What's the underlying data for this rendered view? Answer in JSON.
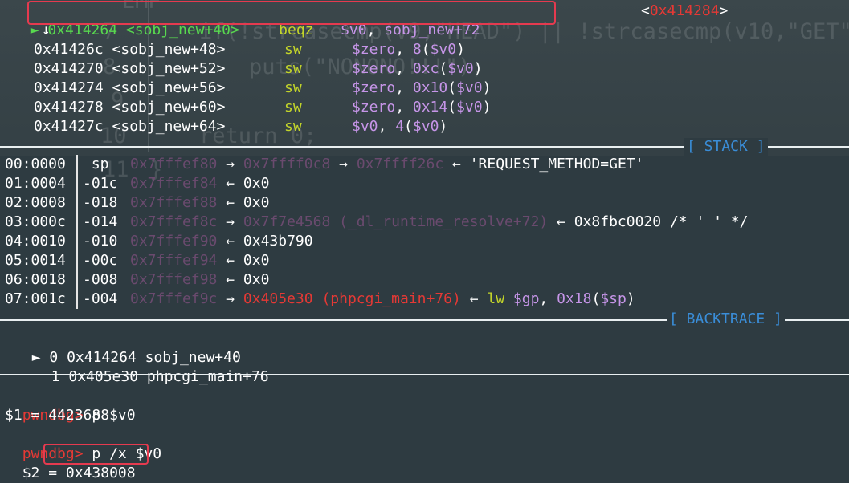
{
  "ghost": {
    "l7_num": "7",
    "l7_code": "if(!strcasecmp(v9,\"HEAD\") || !strcasecmp(v10,\"GET\"",
    "l8_num": "8",
    "l8_code": "puts(\"NONONO!!!\");",
    "l9_num": "9",
    "l10_num": "10",
    "l10_code": "return 0;",
    "l11_num": "11",
    "l11_code": "}",
    "top_frag": "EMP  "
  },
  "disasm": {
    "current": {
      "marker": "►",
      "addr": "0x414264",
      "sym": "<sobj_new+40>",
      "mnemonic": "beqz",
      "op1": "$v0",
      "op2": "sobj_new+72",
      "target_lt": "<",
      "target": "0x414284",
      "target_gt": ">"
    },
    "arrow": "↓",
    "lines": [
      {
        "addr": "0x41426c",
        "sym": "<sobj_new+48>",
        "mnemonic": "sw",
        "op1": "$zero",
        "off": "8",
        "base": "$v0"
      },
      {
        "addr": "0x414270",
        "sym": "<sobj_new+52>",
        "mnemonic": "sw",
        "op1": "$zero",
        "off": "0xc",
        "base": "$v0"
      },
      {
        "addr": "0x414274",
        "sym": "<sobj_new+56>",
        "mnemonic": "sw",
        "op1": "$zero",
        "off": "0x10",
        "base": "$v0"
      },
      {
        "addr": "0x414278",
        "sym": "<sobj_new+60>",
        "mnemonic": "sw",
        "op1": "$zero",
        "off": "0x14",
        "base": "$v0"
      },
      {
        "addr": "0x41427c",
        "sym": "<sobj_new+64>",
        "mnemonic": "sw",
        "op1": "$v0",
        "off": "4",
        "base": "$v0"
      }
    ]
  },
  "stack": {
    "title": "[ STACK ]",
    "rows": [
      {
        "idx": "00:0000",
        "off": " sp",
        "addr": "0x7fffef80",
        "a1": "→",
        "p1": "0x7ffff0c8",
        "a2": "→",
        "p2": "0x7ffff26c",
        "a3": "←",
        "val": "'REQUEST_METHOD=GET'"
      },
      {
        "idx": "01:0004",
        "off": "-01c",
        "addr": "0x7fffef84",
        "a3": "←",
        "val": "0x0"
      },
      {
        "idx": "02:0008",
        "off": "-018",
        "addr": "0x7fffef88",
        "a3": "←",
        "val": "0x0"
      },
      {
        "idx": "03:000c",
        "off": "-014",
        "addr": "0x7fffef8c",
        "a1": "→",
        "p1": "0x7f7e4568 (_dl_runtime_resolve+72)",
        "a3": "←",
        "val": "0x8fbc0020 /* ' ' */"
      },
      {
        "idx": "04:0010",
        "off": "-010",
        "addr": "0x7fffef90",
        "a3": "←",
        "val": "0x43b790"
      },
      {
        "idx": "05:0014",
        "off": "-00c",
        "addr": "0x7fffef94",
        "a3": "←",
        "val": "0x0"
      },
      {
        "idx": "06:0018",
        "off": "-008",
        "addr": "0x7fffef98",
        "a3": "←",
        "val": "0x0"
      },
      {
        "idx": "07:001c",
        "off": "-004",
        "addr": "0x7fffef9c",
        "a1": "→",
        "p1": "0x405e30 (phpcgi_main+76)",
        "a3": "←",
        "ins": "lw",
        "ins_r1": "$gp",
        "ins_sep": ", ",
        "ins_off": "0x18",
        "ins_base": "$sp"
      }
    ]
  },
  "backtrace": {
    "title": "[ BACKTRACE ]",
    "marker": "►",
    "frames": [
      {
        "n": "0",
        "addr": "0x414264",
        "sym": "sobj_new+40"
      },
      {
        "n": "1",
        "addr": "0x405e30",
        "sym": "phpcgi_main+76"
      }
    ]
  },
  "console": {
    "prompt": "pwndbg>",
    "cmd1": "p $v0",
    "out1": "$1 = 4423688",
    "cmd2": "p /x $v0",
    "out2_label": "$2 =",
    "out2_value": "0x438008"
  },
  "colors": {
    "background": "#2e3b41",
    "highlight_box": "#e53a4f",
    "mnemonic": "#c3d52a",
    "register": "#c695e8",
    "red": "#e53935",
    "section_title": "#3a8dd8"
  }
}
